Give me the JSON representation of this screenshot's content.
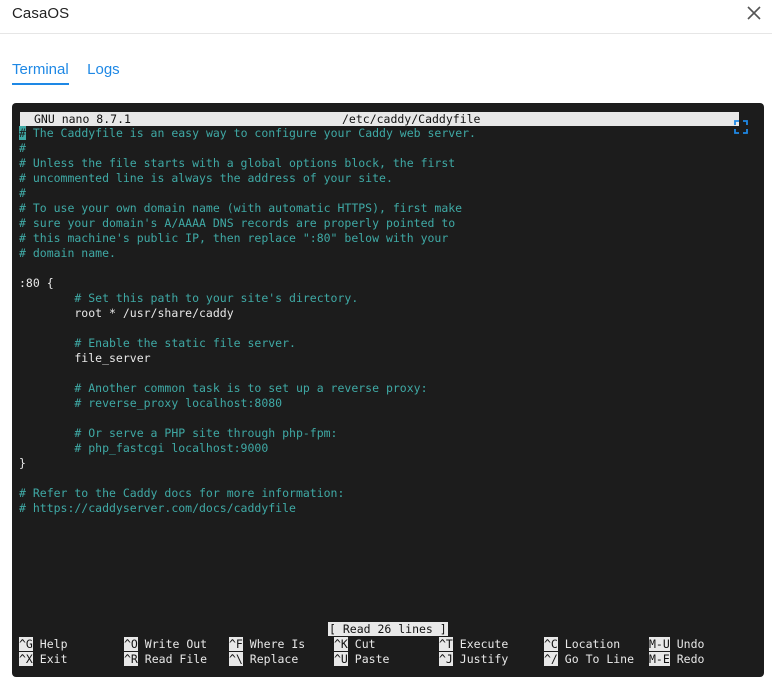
{
  "app": {
    "title": "CasaOS"
  },
  "tabs": [
    {
      "label": "Terminal",
      "active": true
    },
    {
      "label": "Logs",
      "active": false
    }
  ],
  "nano": {
    "version": "GNU nano 8.7.1",
    "filename": "/etc/caddy/Caddyfile",
    "status": "[ Read 26 lines ]",
    "lines": [
      {
        "text": "# The Caddyfile is an easy way to configure your Caddy web server.",
        "type": "comment",
        "cursor": true
      },
      {
        "text": "#",
        "type": "comment"
      },
      {
        "text": "# Unless the file starts with a global options block, the first",
        "type": "comment"
      },
      {
        "text": "# uncommented line is always the address of your site.",
        "type": "comment"
      },
      {
        "text": "#",
        "type": "comment"
      },
      {
        "text": "# To use your own domain name (with automatic HTTPS), first make",
        "type": "comment"
      },
      {
        "text": "# sure your domain's A/AAAA DNS records are properly pointed to",
        "type": "comment"
      },
      {
        "text": "# this machine's public IP, then replace \":80\" below with your",
        "type": "comment"
      },
      {
        "text": "# domain name.",
        "type": "comment"
      },
      {
        "text": "",
        "type": "text"
      },
      {
        "text": ":80 {",
        "type": "text"
      },
      {
        "text": "        # Set this path to your site's directory.",
        "type": "comment"
      },
      {
        "text": "        root * /usr/share/caddy",
        "type": "text"
      },
      {
        "text": "",
        "type": "text"
      },
      {
        "text": "        # Enable the static file server.",
        "type": "comment"
      },
      {
        "text": "        file_server",
        "type": "text"
      },
      {
        "text": "",
        "type": "text"
      },
      {
        "text": "        # Another common task is to set up a reverse proxy:",
        "type": "comment"
      },
      {
        "text": "        # reverse_proxy localhost:8080",
        "type": "comment"
      },
      {
        "text": "",
        "type": "text"
      },
      {
        "text": "        # Or serve a PHP site through php-fpm:",
        "type": "comment"
      },
      {
        "text": "        # php_fastcgi localhost:9000",
        "type": "comment"
      },
      {
        "text": "}",
        "type": "text"
      },
      {
        "text": "",
        "type": "text"
      },
      {
        "text": "# Refer to the Caddy docs for more information:",
        "type": "comment"
      },
      {
        "text": "# https://caddyserver.com/docs/caddyfile",
        "type": "comment"
      }
    ],
    "shortcuts": [
      [
        {
          "key": "^G",
          "label": "Help"
        },
        {
          "key": "^X",
          "label": "Exit"
        }
      ],
      [
        {
          "key": "^O",
          "label": "Write Out"
        },
        {
          "key": "^R",
          "label": "Read File"
        }
      ],
      [
        {
          "key": "^F",
          "label": "Where Is"
        },
        {
          "key": "^\\",
          "label": "Replace"
        }
      ],
      [
        {
          "key": "^K",
          "label": "Cut"
        },
        {
          "key": "^U",
          "label": "Paste"
        }
      ],
      [
        {
          "key": "^T",
          "label": "Execute"
        },
        {
          "key": "^J",
          "label": "Justify"
        }
      ],
      [
        {
          "key": "^C",
          "label": "Location"
        },
        {
          "key": "^/",
          "label": "Go To Line"
        }
      ],
      [
        {
          "key": "M-U",
          "label": "Undo"
        },
        {
          "key": "M-E",
          "label": "Redo"
        }
      ]
    ]
  },
  "icons": {
    "close": "close-icon",
    "fullscreen": "fullscreen-icon"
  },
  "colors": {
    "accent": "#1e88e5",
    "comment": "#3fa9a5",
    "terminal_bg": "#1c1c1c"
  }
}
